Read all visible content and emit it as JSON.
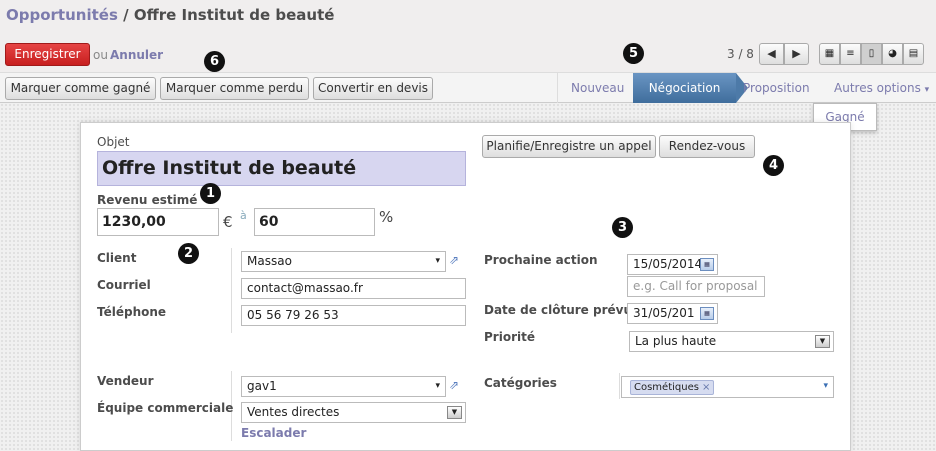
{
  "breadcrumb": {
    "parent": "Opportunités",
    "separator": "/",
    "current": "Offre Institut de beauté"
  },
  "toolbar": {
    "save_label": "Enregistrer",
    "or_label": "ou",
    "cancel_label": "Annuler"
  },
  "pager": {
    "text": "3 / 8",
    "prev_icon": "◀",
    "next_icon": "▶"
  },
  "views": [
    {
      "icon": "▦",
      "name": "kanban"
    },
    {
      "icon": "≡",
      "name": "list"
    },
    {
      "icon": "▯",
      "name": "form"
    },
    {
      "icon": "◕",
      "name": "graph"
    },
    {
      "icon": "▤",
      "name": "calendar"
    }
  ],
  "actions": {
    "mark_won": "Marquer comme gagné",
    "mark_lost": "Marquer comme perdu",
    "convert": "Convertir en devis"
  },
  "stages": {
    "new": "Nouveau",
    "negotiation": "Négociation",
    "proposal": "Proposition",
    "more": "Autres options",
    "more_caret": "▾"
  },
  "dropdown": {
    "won": "Gagné"
  },
  "form": {
    "subject_label": "Objet",
    "subject_value": "Offre Institut de beauté",
    "revenue_label": "Revenu estimé",
    "revenue_value": "1230,00",
    "currency": "€",
    "at": "à",
    "probability_value": "60",
    "percent": "%",
    "call_button": "Planifie/Enregistre un appel",
    "meeting_button": "Rendez-vous",
    "client_label": "Client",
    "client_value": "Massao",
    "email_label": "Courriel",
    "email_value": "contact@massao.fr",
    "phone_label": "Téléphone",
    "phone_value": "05 56 79 26 53",
    "next_action_label": "Prochaine action",
    "next_action_date": "15/05/2014",
    "next_action_placeholder": "e.g. Call for proposal",
    "close_date_label": "Date de clôture prévue",
    "close_date_value": "31/05/201",
    "priority_label": "Priorité",
    "priority_value": "La plus haute",
    "salesperson_label": "Vendeur",
    "salesperson_value": "gav1",
    "team_label": "Équipe commerciale",
    "team_value": "Ventes directes",
    "escalate_label": "Escalader",
    "categories_label": "Catégories",
    "category_tag": "Cosmétiques",
    "tag_remove": "×",
    "dropdown_caret": "▾",
    "select_caret": "▼"
  },
  "markers": [
    "1",
    "2",
    "3",
    "4",
    "5",
    "6"
  ]
}
